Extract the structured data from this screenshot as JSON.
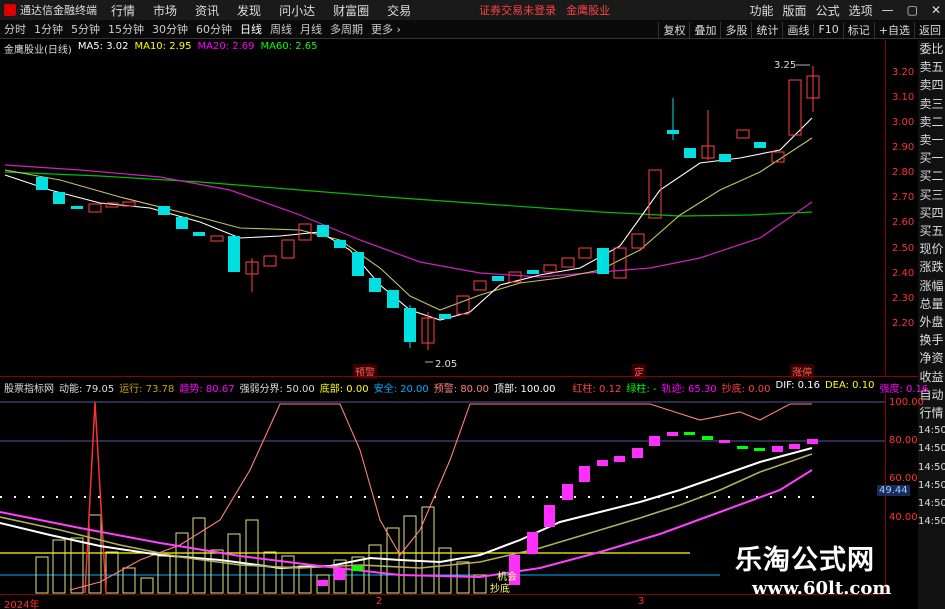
{
  "titlebar": {
    "app_title": "通达信金融终端",
    "menu": [
      "行情",
      "市场",
      "资讯",
      "发现",
      "问小达",
      "财富圈",
      "交易"
    ],
    "alert": "证券交易未登录",
    "stock_name": "金鹰股业",
    "right_menu": [
      "功能",
      "版面",
      "公式",
      "选项"
    ],
    "window_buttons": [
      "—",
      "▢",
      "✕"
    ]
  },
  "toolbar": {
    "timeframes": [
      "分时",
      "1分钟",
      "5分钟",
      "15分钟",
      "30分钟",
      "60分钟",
      "日线",
      "周线",
      "月线",
      "多周期"
    ],
    "active": "日线",
    "more": "更多 ›",
    "right_tools": [
      "复权",
      "叠加",
      "多股",
      "统计",
      "画线",
      "F10",
      "标记",
      "+自选",
      "返回"
    ]
  },
  "ma_line": {
    "name": "金鹰股业(日线)",
    "ma5": "MA5: 3.02",
    "ma10": "MA10: 2.95",
    "ma20": "MA20: 2.69",
    "ma60": "MA60: 2.65",
    "colors": {
      "ma5": "#ffffff",
      "ma10": "#ffff00",
      "ma20": "#ff00ff",
      "ma60": "#00ff00"
    }
  },
  "price_axis": [
    "3.20",
    "3.10",
    "3.00",
    "2.90",
    "2.80",
    "2.70",
    "2.60",
    "2.50",
    "2.40",
    "2.30",
    "2.20"
  ],
  "price_annotations": {
    "high": "3.25",
    "low": "2.05"
  },
  "badges": [
    "预警",
    "定",
    "涨停"
  ],
  "right_panel": [
    "委比",
    "卖五",
    "卖四",
    "卖三",
    "卖二",
    "卖一",
    "买一",
    "买二",
    "买三",
    "买四",
    "买五",
    "现价",
    "涨跌",
    "涨幅",
    "总量",
    "外盘",
    "换手",
    "净资",
    "收益",
    "自动",
    "行情",
    "14:50",
    "14:50",
    "14:50",
    "14:50",
    "14:50",
    "14:50"
  ],
  "indicator": {
    "name": "股票指标网",
    "items": [
      {
        "label": "动能: 79.05",
        "color": "#dddddd"
      },
      {
        "label": "运行: 73.78",
        "color": "#c8a000"
      },
      {
        "label": "趋势: 80.67",
        "color": "#ff00ff"
      },
      {
        "label": "强弱分界: 50.00",
        "color": "#dddddd"
      },
      {
        "label": "底部: 0.00",
        "color": "#ffff00"
      },
      {
        "label": "安全: 20.00",
        "color": "#00b0ff"
      },
      {
        "label": "预警: 80.00",
        "color": "#ff8080"
      },
      {
        "label": "顶部: 100.00",
        "color": "#ffffff"
      },
      {
        "label": "红柱: 0.12",
        "color": "#ff4040"
      },
      {
        "label": "绿柱: -",
        "color": "#00ff00"
      },
      {
        "label": "轨迹: 65.30",
        "color": "#ff00ff"
      },
      {
        "label": "抄底: 0.00",
        "color": "#ff4040"
      },
      {
        "label": "DIF: 0.16",
        "color": "#ffffff"
      },
      {
        "label": "DEA: 0.10",
        "color": "#ffff00"
      },
      {
        "label": "强度: 0.16",
        "color": "#ff00ff"
      }
    ],
    "axis": [
      "100.00",
      "80.00",
      "60.00",
      "40.00"
    ],
    "current": "49.44"
  },
  "date_axis": [
    "2024年",
    "2",
    "3"
  ],
  "watermark": {
    "title": "乐淘公式网",
    "url": "www.60lt.com"
  }
}
